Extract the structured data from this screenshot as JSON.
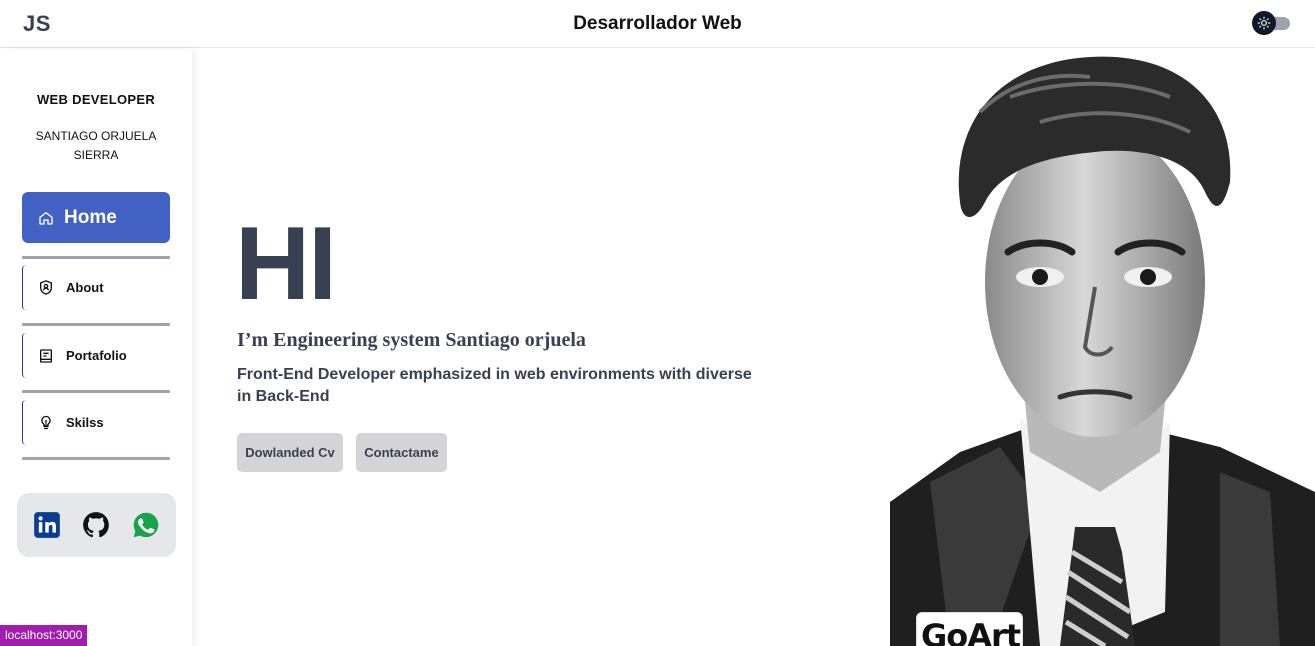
{
  "header": {
    "logo": "JS",
    "title": "Desarrollador Web",
    "theme_toggle_icon": "sun-icon"
  },
  "sidebar": {
    "role": "WEB DEVELOPER",
    "name": "SANTIAGO ORJUELA SIERRA",
    "nav": [
      {
        "label": "Home",
        "icon": "home-icon",
        "active": true
      },
      {
        "label": "About",
        "icon": "user-badge-icon"
      },
      {
        "label": "Portafolio",
        "icon": "portfolio-icon"
      },
      {
        "label": "Skilss",
        "icon": "lightbulb-icon"
      }
    ],
    "social": [
      {
        "icon": "linkedin-icon",
        "color": "#0a3d91"
      },
      {
        "icon": "github-icon",
        "color": "#111111"
      },
      {
        "icon": "whatsapp-icon",
        "color": "#16a34a"
      }
    ]
  },
  "hero": {
    "greeting": "HI",
    "intro": "I’m Engineering system Santiago orjuela",
    "description": "Front-End Developer emphasized in web environments with diverse in Back-End",
    "buttons": {
      "cv": "Dowlanded Cv",
      "contact": "Contactame"
    }
  },
  "portrait": {
    "watermark": "GoArt"
  },
  "status": {
    "url": "localhost:3000"
  },
  "colors": {
    "accent": "#4361c2",
    "nav_border": "#1e3a8a",
    "separator": "#9ca3af"
  }
}
